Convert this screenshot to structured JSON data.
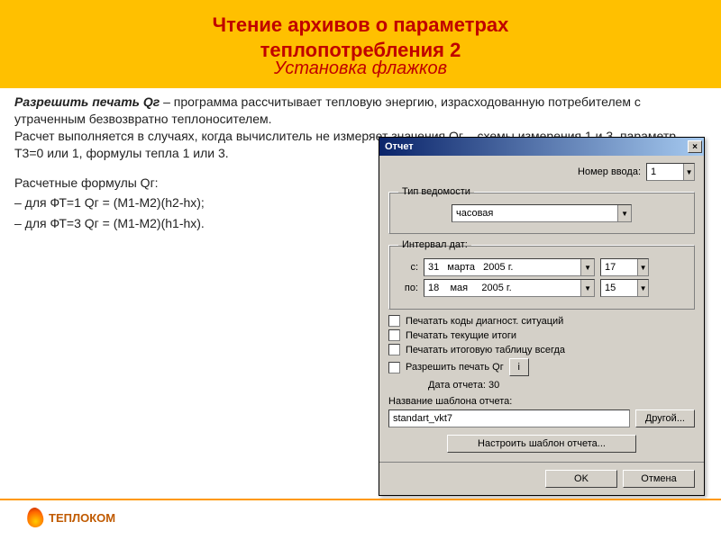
{
  "header": {
    "title_line1": "Чтение архивов о параметрах",
    "title_line2": "теплопотребления 2",
    "subtitle": "Установка флажков"
  },
  "intro": {
    "lead": "Разрешить печать Qг",
    "text1": " – программа рассчитывает тепловую энергию, израсходованную потребителем с утраченным безвозвратно теплоносителем.",
    "text2": "Расчет выполняется в случаях, когда вычислитель не измеряет значения Qг – схемы измерения 1 и 3, параметр Т3=0 или 1, формулы тепла 1 или 3."
  },
  "formulas": {
    "heading": "Расчетные формулы Qг:",
    "f1": "– для ФТ=1 Qг = (М1-М2)(h2-hx);",
    "f2": "– для ФТ=3 Qг = (М1-М2)(h1-hx)."
  },
  "dialog": {
    "title": "Отчет",
    "input_number_label": "Номер ввода:",
    "input_number_value": "1",
    "type_group": "Тип ведомости",
    "type_value": "часовая",
    "interval_group": "Интервал дат:",
    "from_label": "с:",
    "from_date": "31   марта   2005 г.",
    "from_hour": "17",
    "to_label": "по:",
    "to_date": "18    мая     2005 г.",
    "to_hour": "15",
    "chk1": "Печатать коды диагност. ситуаций",
    "chk2": "Печатать текущие итоги",
    "chk3": "Печатать итоговую таблицу всегда",
    "chk4": "Разрешить печать Qг",
    "info_btn": "i",
    "report_date_label": "Дата отчета: 30",
    "template_label": "Название шаблона отчета:",
    "template_value": "standart_vkt7",
    "other_btn": "Другой...",
    "configure_btn": "Настроить шаблон отчета...",
    "ok": "OK",
    "cancel": "Отмена"
  },
  "footer": {
    "brand": "ТЕПЛОКОМ"
  }
}
